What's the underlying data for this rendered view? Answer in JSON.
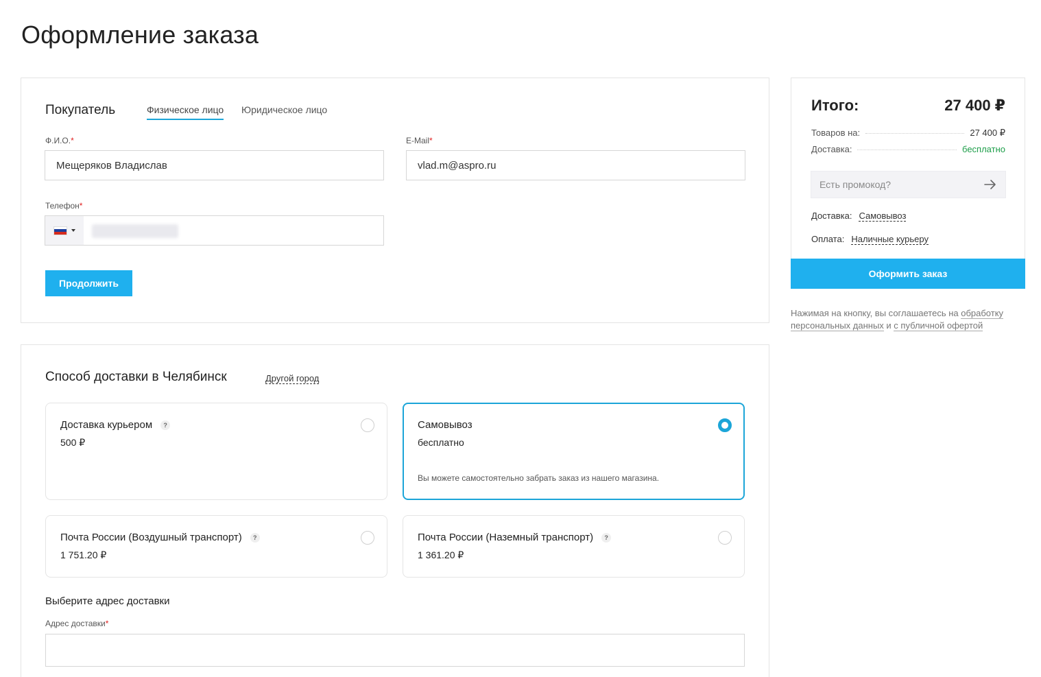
{
  "page": {
    "title": "Оформление заказа"
  },
  "buyer": {
    "title": "Покупатель",
    "tabs": [
      {
        "label": "Физическое лицо",
        "active": true
      },
      {
        "label": "Юридическое лицо",
        "active": false
      }
    ],
    "fio": {
      "label": "Ф.И.О.",
      "required": "*",
      "value": "Мещеряков Владислав"
    },
    "email": {
      "label": "E-Mail",
      "required": "*",
      "value": "vlad.m@aspro.ru"
    },
    "phone": {
      "label": "Телефон",
      "required": "*",
      "country_icon": "russia-flag-icon"
    },
    "continue_label": "Продолжить"
  },
  "delivery": {
    "title": "Способ доставки в Челябинск",
    "other_city": "Другой город",
    "options": [
      {
        "title": "Доставка курьером",
        "price": "500 ₽",
        "selected": false
      },
      {
        "title": "Самовывоз",
        "price": "бесплатно",
        "desc": "Вы можете самостоятельно забрать заказ из нашего магазина.",
        "selected": true
      },
      {
        "title": "Почта России (Воздушный транспорт)",
        "price": "1 751.20 ₽",
        "selected": false
      },
      {
        "title": "Почта России (Наземный транспорт)",
        "price": "1 361.20 ₽",
        "selected": false
      }
    ],
    "address_title": "Выберите адрес доставки",
    "address": {
      "label": "Адрес доставки",
      "required": "*",
      "value": ""
    }
  },
  "summary": {
    "total_label": "Итого:",
    "total_value": "27 400 ₽",
    "goods_label": "Товаров на:",
    "goods_value": "27 400 ₽",
    "shipping_label": "Доставка:",
    "shipping_value": "бесплатно",
    "promo_placeholder": "Есть промокод?",
    "delivery_label": "Доставка:",
    "delivery_value": "Самовывоз",
    "payment_label": "Оплата:",
    "payment_value": "Наличные курьеру",
    "submit_label": "Оформить заказ",
    "colors": {
      "accent": "#1fb0ee",
      "active_border": "#1ba5d8",
      "free": "#1e9e4a"
    }
  },
  "agreement": {
    "text1": "Нажимая на кнопку, вы соглашаетесь на ",
    "link1": "обработку персональных данных",
    "text2": " и ",
    "link2": "с публичной офертой"
  }
}
